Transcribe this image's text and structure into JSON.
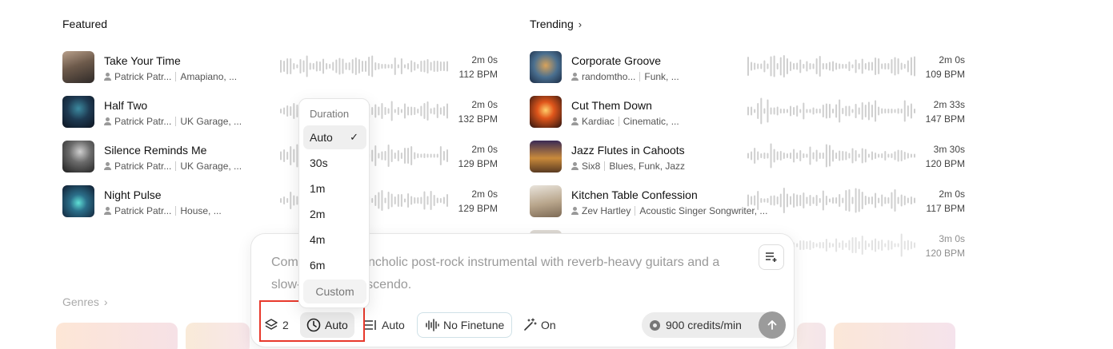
{
  "featured": {
    "title": "Featured",
    "tracks": [
      {
        "title": "Take Your Time",
        "artist": "Patrick Patr...",
        "genre": "Amapiano, ...",
        "duration": "2m 0s",
        "bpm": "112 BPM"
      },
      {
        "title": "Half Two",
        "artist": "Patrick Patr...",
        "genre": "UK Garage, ...",
        "duration": "2m 0s",
        "bpm": "132 BPM"
      },
      {
        "title": "Silence Reminds Me",
        "artist": "Patrick Patr...",
        "genre": "UK Garage, ...",
        "duration": "2m 0s",
        "bpm": "129 BPM"
      },
      {
        "title": "Night Pulse",
        "artist": "Patrick Patr...",
        "genre": "House, ...",
        "duration": "2m 0s",
        "bpm": "129 BPM"
      }
    ]
  },
  "trending": {
    "title": "Trending",
    "tracks": [
      {
        "title": "Corporate Groove",
        "artist": "randomtho...",
        "genre": "Funk, ...",
        "duration": "2m 0s",
        "bpm": "109 BPM"
      },
      {
        "title": "Cut Them Down",
        "artist": "Kardiac",
        "genre": "Cinematic, ...",
        "duration": "2m 33s",
        "bpm": "147 BPM"
      },
      {
        "title": "Jazz Flutes in Cahoots",
        "artist": "Six8",
        "genre": "Blues, Funk, Jazz",
        "duration": "3m 30s",
        "bpm": "120 BPM"
      },
      {
        "title": "Kitchen Table Confession",
        "artist": "Zev Hartley",
        "genre": "Acoustic Singer Songwriter, ...",
        "duration": "2m 0s",
        "bpm": "117 BPM"
      },
      {
        "title": "",
        "artist": "",
        "genre": "",
        "duration": "3m 0s",
        "bpm": "120 BPM"
      }
    ]
  },
  "genres": {
    "label": "Genres"
  },
  "composer": {
    "prompt": "Compose a melancholic post-rock instrumental with reverb-heavy guitars and a slow-building crescendo.",
    "count": "2",
    "duration_value": "Auto",
    "lyrics_value": "Auto",
    "finetune_label": "No Finetune",
    "enhance_value": "On",
    "credits": "900 credits/min"
  },
  "duration_menu": {
    "header": "Duration",
    "options": [
      "Auto",
      "30s",
      "1m",
      "2m",
      "4m",
      "6m"
    ],
    "selected_index": 0,
    "custom_label": "Custom"
  },
  "colors": {
    "highlight": "#e8392c",
    "accent_border": "#cfe1e7"
  }
}
